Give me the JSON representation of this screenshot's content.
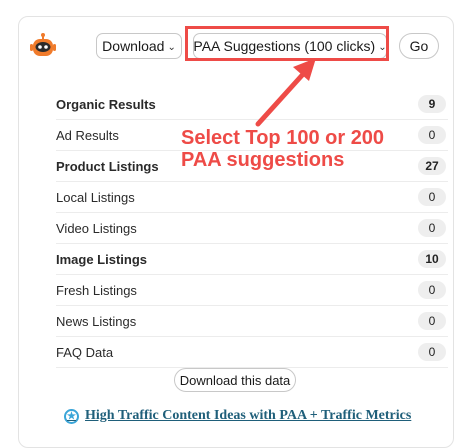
{
  "toolbar": {
    "download_label": "Download",
    "paa_label": "PAA Suggestions (100 clicks)",
    "go_label": "Go",
    "robot_icon": "robot-icon"
  },
  "results": [
    {
      "label": "Organic Results",
      "count": "9",
      "bold": true
    },
    {
      "label": "Ad Results",
      "count": "0",
      "bold": false
    },
    {
      "label": "Product Listings",
      "count": "27",
      "bold": true
    },
    {
      "label": "Local Listings",
      "count": "0",
      "bold": false
    },
    {
      "label": "Video Listings",
      "count": "0",
      "bold": false
    },
    {
      "label": "Image Listings",
      "count": "10",
      "bold": true
    },
    {
      "label": "Fresh Listings",
      "count": "0",
      "bold": false
    },
    {
      "label": "News Listings",
      "count": "0",
      "bold": false
    },
    {
      "label": "FAQ Data",
      "count": "0",
      "bold": false
    }
  ],
  "footer": {
    "export_label": "Download this data",
    "ideas_link": "High Traffic Content Ideas with PAA + Traffic Metrics"
  },
  "annotation": {
    "line1": "Select Top 100 or 200",
    "line2": "PAA suggestions",
    "color": "#ee4b47"
  },
  "colors": {
    "accent_orange": "#f07b2b",
    "annotation_red": "#ee4b47",
    "link_blue": "#1f5f7a"
  }
}
